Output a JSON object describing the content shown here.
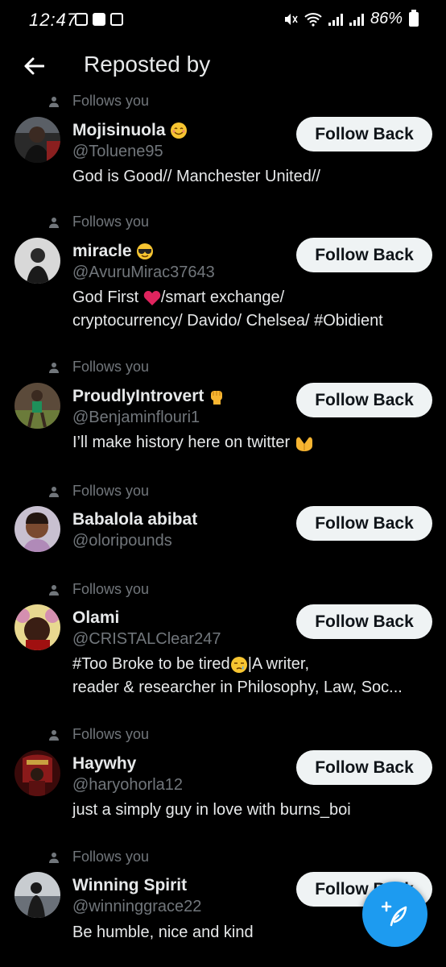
{
  "status_bar": {
    "time": "12:47",
    "battery": "86%"
  },
  "header": {
    "title": "Reposted by"
  },
  "follows_you_label": "Follows you",
  "follow_back_label": "Follow Back",
  "users": [
    {
      "name": "Mojisinuola",
      "handle": "@Toluene95",
      "bio": [
        "God is Good// Manchester United//"
      ]
    },
    {
      "name": "miracle",
      "handle": "@AvuruMirac37643",
      "bio": [
        "God First",
        "/smart exchange/",
        "cryptocurrency/ Davido/ Chelsea/ #Obidient"
      ]
    },
    {
      "name": "ProudlyIntrovert",
      "handle": "@Benjaminflouri1",
      "bio": [
        "I’ll make history here on twitter"
      ]
    },
    {
      "name": "Babalola abibat",
      "handle": "@oloripounds",
      "bio": []
    },
    {
      "name": "Olami",
      "handle": "@CRISTALClear247",
      "bio": [
        "#Too Broke to be tired",
        "|A writer,",
        "reader & researcher in Philosophy, Law, Soc..."
      ]
    },
    {
      "name": "Haywhy",
      "handle": "@haryohorla12",
      "bio": [
        "just a simply guy in love with burns_boi"
      ]
    },
    {
      "name": "Winning Spirit",
      "handle": "@winninggrace22",
      "bio": [
        "Be humble, nice and kind"
      ]
    }
  ],
  "colors": {
    "accent": "#1d9bf0",
    "background": "#000000",
    "secondary_text": "#71767b",
    "button_bg": "#eff3f4"
  },
  "icons": {
    "back": "arrow-left-icon",
    "person": "person-icon",
    "fab": "compose-feather-icon"
  }
}
